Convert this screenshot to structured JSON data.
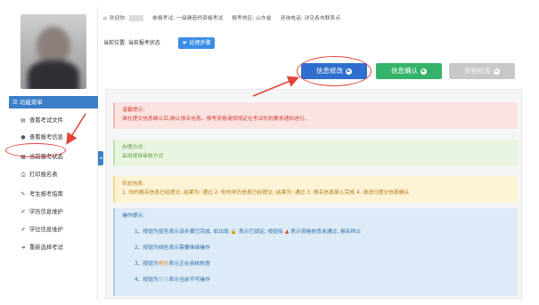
{
  "topbar": {
    "welcome": "欢迎你:",
    "exam": "参报考试: 一级建造师资格考试",
    "region": "报考地区: 山东省",
    "phone": "咨询电话: 详见各市联系点"
  },
  "sidebar": {
    "menu_title": "功能菜单",
    "items": [
      {
        "label": "查看考试文件",
        "icon": "document-icon"
      },
      {
        "label": "查看报考信息",
        "icon": "info-icon"
      },
      {
        "label": "当前报考状态",
        "icon": "list-icon"
      },
      {
        "label": "打印报名表",
        "icon": "printer-icon"
      },
      {
        "label": "考生报考指南",
        "icon": "guide-icon"
      },
      {
        "label": "学历信息维护",
        "icon": "edit-icon"
      },
      {
        "label": "学位信息维护",
        "icon": "edit-icon"
      },
      {
        "label": "重新选择考试",
        "icon": "arrow-icon"
      }
    ]
  },
  "breadcrumb": {
    "label": "当前位置: 当前报考状态",
    "button": "处理步骤"
  },
  "actions": {
    "edit": "信息修改",
    "confirm": "信息确认",
    "check": "资格检查"
  },
  "notices": {
    "red": {
      "title": "温馨提示:",
      "body": "请在提交信息确认后,确认报名信息。报考资格请按规定在考试机构要求通知进行。"
    },
    "green": {
      "title": "办理方式:",
      "body": "采用现场审核方式"
    },
    "yellow": {
      "title": "状态信息:",
      "body": "1. 你的报名信息已经提交, 结果为: 通过 2. 你的学历信息已经提交, 结果为: 通过 3. 报名信息录入完成 4. 请进行提交信息确认"
    },
    "blue": {
      "title": "操作提示:",
      "steps": [
        {
          "pre": "1、按钮为蓝色表示该步骤已完成, 如出现",
          "lock": "🔒",
          "mid": "表示已锁定; 按钮有",
          "warn": "▲",
          "post": "表示资格核查未通过, 报名终止"
        },
        {
          "text": "2、按钮为绿色表示需要继续操作"
        },
        {
          "pre": "3、按钮为",
          "orange": "橙色",
          "post": "表示正在审核核查"
        },
        {
          "pre": "4、按钮为",
          "faint": "灰色",
          "post": "表示当前不可操作"
        }
      ]
    }
  },
  "colors": {
    "primary": "#2f6fcd",
    "success": "#36b36b",
    "disabled": "#c8c8c8",
    "annotation": "#e0453a"
  }
}
